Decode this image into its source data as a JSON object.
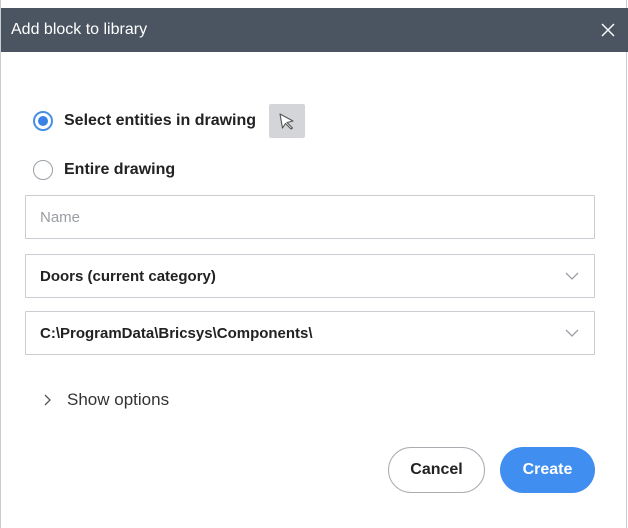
{
  "dialog": {
    "title": "Add block to library",
    "close_icon": "close-icon"
  },
  "source": {
    "options": [
      {
        "label": "Select entities in drawing",
        "selected": true
      },
      {
        "label": "Entire drawing",
        "selected": false
      }
    ],
    "pick_icon": "cursor-select-icon"
  },
  "name_field": {
    "value": "",
    "placeholder": "Name"
  },
  "category_select": {
    "value": "Doors (current category)"
  },
  "path_select": {
    "value": "C:\\ProgramData\\Bricsys\\Components\\"
  },
  "show_options": {
    "label": "Show options",
    "expanded": false
  },
  "buttons": {
    "cancel": "Cancel",
    "create": "Create"
  },
  "colors": {
    "titlebar": "#4b5561",
    "accent": "#3f8ef0",
    "radio_selected": "#3b82e6"
  }
}
